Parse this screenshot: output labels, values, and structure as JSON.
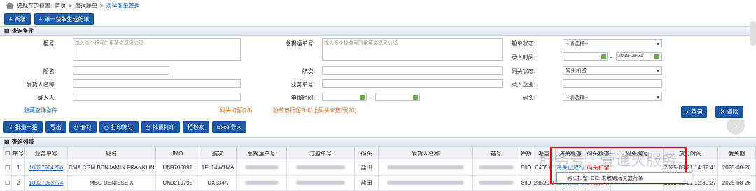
{
  "breadcrumb": {
    "prefix": "您现在的位置:",
    "items": [
      "首页",
      "海运舱单",
      "海运舱单管理"
    ],
    "sep": ">"
  },
  "toolbar": {
    "new": "新增",
    "fetch": "单一获取生成舱单"
  },
  "query": {
    "title": "查询条件",
    "box_no_label": "柜号:",
    "box_no_ph": "输入多个柜号时用英文逗号分隔",
    "bl_label": "总提运单号:",
    "bl_ph": "输入多个提单号时用英文逗号分隔",
    "status_label": "舱单状态:",
    "status_val": "--请选择--",
    "entry_time_label": "录入时间:",
    "entry_from": "",
    "entry_to": "2025-08-21",
    "ship_label": "船名:",
    "voyage_label": "航次:",
    "dock_status_label": "码头状态:",
    "dock_status_val": "码头扣留",
    "shipper_label": "发货人名称:",
    "biz_no_label": "业务单号:",
    "entry_company_label": "录入企业:",
    "entry_person_label": "录入人:",
    "declare_time_label": "申报时间:",
    "dash": "-",
    "dock_label": "码头:",
    "dock_val": "--请选择--",
    "hide": "隐藏查询条件",
    "dock_hold": "码头扣留(28)",
    "overdue": "舱单放行超2h以上码头未放行(20)",
    "search": "查询",
    "clear": "清除"
  },
  "actions": [
    "批量申报",
    "导出",
    "套打",
    "打印修订",
    "批量打印",
    "柜检索",
    "Excel导入"
  ],
  "list": {
    "title": "查询列表",
    "headers": [
      "序号",
      "业务单号",
      "船名",
      "IMO",
      "航次",
      "总提运单号",
      "订舱单号",
      "码头",
      "发货人名称",
      "箱号",
      "件数",
      "毛重",
      "海关状态",
      "码头状态",
      "码头编号",
      "放行时间",
      "截关期"
    ],
    "rows": [
      {
        "no": "1",
        "biz": "10027964256",
        "ship": "CMA CGM BENJAMIN FRANKLIN",
        "imo": "UN9706891",
        "voy": "1FL14W1MA",
        "dock": "盐田",
        "pcs": "500",
        "wt": "6465.0",
        "customs": "海关已放行",
        "dock_status": "码头扣留",
        "release": "2025-08-21 14:32:41",
        "cut": "2025-08-26"
      },
      {
        "no": "2",
        "biz": "10027963774",
        "ship": "MSC DENISSE X",
        "imo": "UN9219795",
        "voy": "UX534A",
        "dock": "盐田",
        "pcs": "889",
        "wt": "28520.0",
        "customs": "海关已放行",
        "dock_status": "码头扣留",
        "release": "2025-08-21 12:30:27",
        "cut": "2025-08-26"
      }
    ]
  },
  "tooltip": "码头扣留: DC: 未收到海关放行条",
  "watermark": "服务号 · 壹通关服务"
}
